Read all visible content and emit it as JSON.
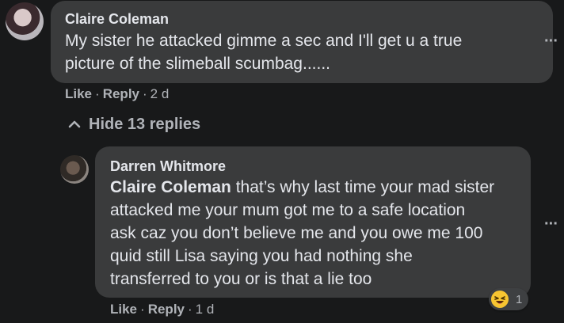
{
  "comment": {
    "author": "Claire Coleman",
    "text_line1": "My sister he attacked gimme a sec and I'll get u a true",
    "text_line2": "picture of the slimeball scumbag......",
    "actions": {
      "like": "Like",
      "reply": "Reply",
      "age": "2 d"
    },
    "hide_replies": "Hide 13 replies"
  },
  "reply": {
    "author": "Darren Whitmore",
    "mention": "Claire Coleman",
    "text_line1_rest": " that’s why last time your mad sister",
    "text_line2": "attacked me your mum got me to a safe location",
    "text_line3": "ask caz you don’t believe me and you owe me 100",
    "text_line4": "quid still Lisa saying you had nothing she",
    "text_line5": "transferred to you or is that a lie too",
    "actions": {
      "like": "Like",
      "reply": "Reply",
      "age": "1 d"
    },
    "reaction": {
      "icon": "laughing-emoji-icon",
      "count": "1"
    }
  },
  "more_icon": "···",
  "separator": "·",
  "colors": {
    "bg": "#18191a",
    "bubble": "#3a3b3c",
    "text": "#e4e6eb",
    "muted": "#b0b3b8",
    "emoji": "#f7c531"
  }
}
